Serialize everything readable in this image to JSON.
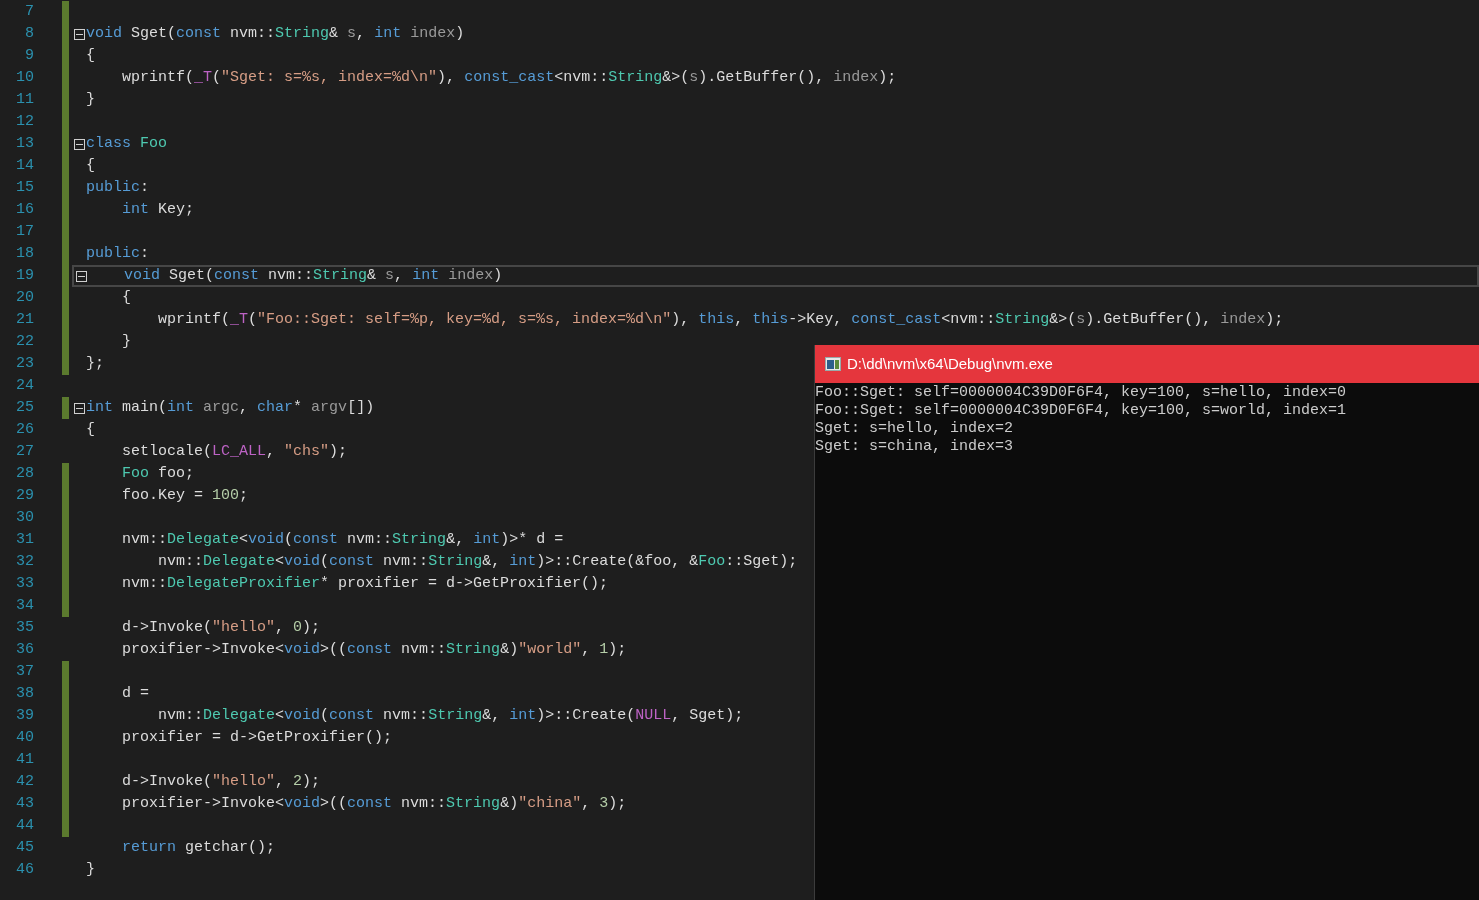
{
  "editor": {
    "lines": [
      {
        "number": "7",
        "modified": true,
        "fold": false,
        "current": false
      },
      {
        "number": "8",
        "modified": true,
        "fold": true,
        "current": false,
        "tokens": [
          {
            "kind": "keyword",
            "text": "void"
          },
          {
            "kind": "plain",
            "text": " Sget("
          },
          {
            "kind": "keyword",
            "text": "const"
          },
          {
            "kind": "plain",
            "text": " nvm::"
          },
          {
            "kind": "type",
            "text": "String"
          },
          {
            "kind": "plain",
            "text": "& "
          },
          {
            "kind": "param",
            "text": "s"
          },
          {
            "kind": "plain",
            "text": ", "
          },
          {
            "kind": "keyword",
            "text": "int"
          },
          {
            "kind": "param",
            "text": " index"
          },
          {
            "kind": "plain",
            "text": ")"
          }
        ]
      },
      {
        "number": "9",
        "modified": true,
        "fold": false,
        "current": false,
        "tokens": [
          {
            "kind": "plain",
            "text": "{"
          }
        ]
      },
      {
        "number": "10",
        "modified": true,
        "fold": false,
        "current": false,
        "tokens": [
          {
            "kind": "plain",
            "text": "    wprintf("
          },
          {
            "kind": "macro",
            "text": "_T"
          },
          {
            "kind": "plain",
            "text": "("
          },
          {
            "kind": "string",
            "text": "\"Sget: s=%s, index=%d\\n\""
          },
          {
            "kind": "plain",
            "text": "), "
          },
          {
            "kind": "keyword",
            "text": "const_cast"
          },
          {
            "kind": "plain",
            "text": "<nvm::"
          },
          {
            "kind": "type",
            "text": "String"
          },
          {
            "kind": "plain",
            "text": "&>("
          },
          {
            "kind": "param",
            "text": "s"
          },
          {
            "kind": "plain",
            "text": ").GetBuffer(), "
          },
          {
            "kind": "param",
            "text": "index"
          },
          {
            "kind": "plain",
            "text": ");"
          }
        ]
      },
      {
        "number": "11",
        "modified": true,
        "fold": false,
        "current": false,
        "tokens": [
          {
            "kind": "plain",
            "text": "}"
          }
        ]
      },
      {
        "number": "12",
        "modified": true,
        "fold": false,
        "current": false
      },
      {
        "number": "13",
        "modified": true,
        "fold": true,
        "current": false,
        "tokens": [
          {
            "kind": "keyword",
            "text": "class"
          },
          {
            "kind": "type",
            "text": " Foo"
          }
        ]
      },
      {
        "number": "14",
        "modified": true,
        "fold": false,
        "current": false,
        "tokens": [
          {
            "kind": "plain",
            "text": "{"
          }
        ]
      },
      {
        "number": "15",
        "modified": true,
        "fold": false,
        "current": false,
        "tokens": [
          {
            "kind": "keyword",
            "text": "public"
          },
          {
            "kind": "plain",
            "text": ":"
          }
        ]
      },
      {
        "number": "16",
        "modified": true,
        "fold": false,
        "current": false,
        "tokens": [
          {
            "kind": "keyword",
            "text": "    int"
          },
          {
            "kind": "plain",
            "text": " Key;"
          }
        ]
      },
      {
        "number": "17",
        "modified": true,
        "fold": false,
        "current": false
      },
      {
        "number": "18",
        "modified": true,
        "fold": false,
        "current": false,
        "tokens": [
          {
            "kind": "keyword",
            "text": "public"
          },
          {
            "kind": "plain",
            "text": ":"
          }
        ]
      },
      {
        "number": "19",
        "modified": true,
        "fold": true,
        "current": true,
        "tokens": [
          {
            "kind": "keyword",
            "text": "    void"
          },
          {
            "kind": "plain",
            "text": " Sget("
          },
          {
            "kind": "keyword",
            "text": "const"
          },
          {
            "kind": "plain",
            "text": " nvm::"
          },
          {
            "kind": "type",
            "text": "String"
          },
          {
            "kind": "plain",
            "text": "& "
          },
          {
            "kind": "param",
            "text": "s"
          },
          {
            "kind": "plain",
            "text": ", "
          },
          {
            "kind": "keyword",
            "text": "int"
          },
          {
            "kind": "param",
            "text": " index"
          },
          {
            "kind": "plain",
            "text": ")"
          }
        ]
      },
      {
        "number": "20",
        "modified": true,
        "fold": false,
        "current": false,
        "tokens": [
          {
            "kind": "plain",
            "text": "    {"
          }
        ]
      },
      {
        "number": "21",
        "modified": true,
        "fold": false,
        "current": false,
        "tokens": [
          {
            "kind": "plain",
            "text": "        wprintf("
          },
          {
            "kind": "macro",
            "text": "_T"
          },
          {
            "kind": "plain",
            "text": "("
          },
          {
            "kind": "string",
            "text": "\"Foo::Sget: self=%p, key=%d, s=%s, index=%d\\n\""
          },
          {
            "kind": "plain",
            "text": "), "
          },
          {
            "kind": "keyword",
            "text": "this"
          },
          {
            "kind": "plain",
            "text": ", "
          },
          {
            "kind": "keyword",
            "text": "this"
          },
          {
            "kind": "plain",
            "text": "->Key, "
          },
          {
            "kind": "keyword",
            "text": "const_cast"
          },
          {
            "kind": "plain",
            "text": "<nvm::"
          },
          {
            "kind": "type",
            "text": "String"
          },
          {
            "kind": "plain",
            "text": "&>("
          },
          {
            "kind": "param",
            "text": "s"
          },
          {
            "kind": "plain",
            "text": ").GetBuffer(), "
          },
          {
            "kind": "param",
            "text": "index"
          },
          {
            "kind": "plain",
            "text": ");"
          }
        ]
      },
      {
        "number": "22",
        "modified": true,
        "fold": false,
        "current": false,
        "tokens": [
          {
            "kind": "plain",
            "text": "    }"
          }
        ]
      },
      {
        "number": "23",
        "modified": true,
        "fold": false,
        "current": false,
        "tokens": [
          {
            "kind": "plain",
            "text": "};"
          }
        ]
      },
      {
        "number": "24",
        "modified": false,
        "fold": false,
        "current": false
      },
      {
        "number": "25",
        "modified": true,
        "fold": true,
        "current": false,
        "tokens": [
          {
            "kind": "keyword",
            "text": "int"
          },
          {
            "kind": "plain",
            "text": " main("
          },
          {
            "kind": "keyword",
            "text": "int"
          },
          {
            "kind": "param",
            "text": " argc"
          },
          {
            "kind": "plain",
            "text": ", "
          },
          {
            "kind": "keyword",
            "text": "char"
          },
          {
            "kind": "plain",
            "text": "* "
          },
          {
            "kind": "param",
            "text": "argv"
          },
          {
            "kind": "plain",
            "text": "[])"
          }
        ]
      },
      {
        "number": "26",
        "modified": false,
        "fold": false,
        "current": false,
        "tokens": [
          {
            "kind": "plain",
            "text": "{"
          }
        ]
      },
      {
        "number": "27",
        "modified": false,
        "fold": false,
        "current": false,
        "tokens": [
          {
            "kind": "plain",
            "text": "    setlocale("
          },
          {
            "kind": "macro",
            "text": "LC_ALL"
          },
          {
            "kind": "plain",
            "text": ", "
          },
          {
            "kind": "string",
            "text": "\"chs\""
          },
          {
            "kind": "plain",
            "text": ");"
          }
        ]
      },
      {
        "number": "28",
        "modified": true,
        "fold": false,
        "current": false,
        "tokens": [
          {
            "kind": "type",
            "text": "    Foo"
          },
          {
            "kind": "plain",
            "text": " foo;"
          }
        ]
      },
      {
        "number": "29",
        "modified": true,
        "fold": false,
        "current": false,
        "tokens": [
          {
            "kind": "plain",
            "text": "    foo.Key = "
          },
          {
            "kind": "number",
            "text": "100"
          },
          {
            "kind": "plain",
            "text": ";"
          }
        ]
      },
      {
        "number": "30",
        "modified": true,
        "fold": false,
        "current": false
      },
      {
        "number": "31",
        "modified": true,
        "fold": false,
        "current": false,
        "tokens": [
          {
            "kind": "plain",
            "text": "    nvm::"
          },
          {
            "kind": "type",
            "text": "Delegate"
          },
          {
            "kind": "plain",
            "text": "<"
          },
          {
            "kind": "keyword",
            "text": "void"
          },
          {
            "kind": "plain",
            "text": "("
          },
          {
            "kind": "keyword",
            "text": "const"
          },
          {
            "kind": "plain",
            "text": " nvm::"
          },
          {
            "kind": "type",
            "text": "String"
          },
          {
            "kind": "plain",
            "text": "&, "
          },
          {
            "kind": "keyword",
            "text": "int"
          },
          {
            "kind": "plain",
            "text": ")>* d ="
          }
        ]
      },
      {
        "number": "32",
        "modified": true,
        "fold": false,
        "current": false,
        "tokens": [
          {
            "kind": "plain",
            "text": "        nvm::"
          },
          {
            "kind": "type",
            "text": "Delegate"
          },
          {
            "kind": "plain",
            "text": "<"
          },
          {
            "kind": "keyword",
            "text": "void"
          },
          {
            "kind": "plain",
            "text": "("
          },
          {
            "kind": "keyword",
            "text": "const"
          },
          {
            "kind": "plain",
            "text": " nvm::"
          },
          {
            "kind": "type",
            "text": "String"
          },
          {
            "kind": "plain",
            "text": "&, "
          },
          {
            "kind": "keyword",
            "text": "int"
          },
          {
            "kind": "plain",
            "text": ")>::Create(&foo, &"
          },
          {
            "kind": "type",
            "text": "Foo"
          },
          {
            "kind": "plain",
            "text": "::Sget);"
          }
        ]
      },
      {
        "number": "33",
        "modified": true,
        "fold": false,
        "current": false,
        "tokens": [
          {
            "kind": "plain",
            "text": "    nvm::"
          },
          {
            "kind": "type",
            "text": "DelegateProxifier"
          },
          {
            "kind": "plain",
            "text": "* proxifier = d->GetProxifier();"
          }
        ]
      },
      {
        "number": "34",
        "modified": true,
        "fold": false,
        "current": false
      },
      {
        "number": "35",
        "modified": false,
        "fold": false,
        "current": false,
        "tokens": [
          {
            "kind": "plain",
            "text": "    d->Invoke("
          },
          {
            "kind": "string",
            "text": "\"hello\""
          },
          {
            "kind": "plain",
            "text": ", "
          },
          {
            "kind": "number",
            "text": "0"
          },
          {
            "kind": "plain",
            "text": ");"
          }
        ]
      },
      {
        "number": "36",
        "modified": false,
        "fold": false,
        "current": false,
        "tokens": [
          {
            "kind": "plain",
            "text": "    proxifier->Invoke<"
          },
          {
            "kind": "keyword",
            "text": "void"
          },
          {
            "kind": "plain",
            "text": ">(("
          },
          {
            "kind": "keyword",
            "text": "const"
          },
          {
            "kind": "plain",
            "text": " nvm::"
          },
          {
            "kind": "type",
            "text": "String"
          },
          {
            "kind": "plain",
            "text": "&)"
          },
          {
            "kind": "string",
            "text": "\"world\""
          },
          {
            "kind": "plain",
            "text": ", "
          },
          {
            "kind": "number",
            "text": "1"
          },
          {
            "kind": "plain",
            "text": ");"
          }
        ]
      },
      {
        "number": "37",
        "modified": true,
        "fold": false,
        "current": false
      },
      {
        "number": "38",
        "modified": true,
        "fold": false,
        "current": false,
        "tokens": [
          {
            "kind": "plain",
            "text": "    d ="
          }
        ]
      },
      {
        "number": "39",
        "modified": true,
        "fold": false,
        "current": false,
        "tokens": [
          {
            "kind": "plain",
            "text": "        nvm::"
          },
          {
            "kind": "type",
            "text": "Delegate"
          },
          {
            "kind": "plain",
            "text": "<"
          },
          {
            "kind": "keyword",
            "text": "void"
          },
          {
            "kind": "plain",
            "text": "("
          },
          {
            "kind": "keyword",
            "text": "const"
          },
          {
            "kind": "plain",
            "text": " nvm::"
          },
          {
            "kind": "type",
            "text": "String"
          },
          {
            "kind": "plain",
            "text": "&, "
          },
          {
            "kind": "keyword",
            "text": "int"
          },
          {
            "kind": "plain",
            "text": ")>::Create("
          },
          {
            "kind": "macro",
            "text": "NULL"
          },
          {
            "kind": "plain",
            "text": ", Sget);"
          }
        ]
      },
      {
        "number": "40",
        "modified": true,
        "fold": false,
        "current": false,
        "tokens": [
          {
            "kind": "plain",
            "text": "    proxifier = d->GetProxifier();"
          }
        ]
      },
      {
        "number": "41",
        "modified": true,
        "fold": false,
        "current": false
      },
      {
        "number": "42",
        "modified": true,
        "fold": false,
        "current": false,
        "tokens": [
          {
            "kind": "plain",
            "text": "    d->Invoke("
          },
          {
            "kind": "string",
            "text": "\"hello\""
          },
          {
            "kind": "plain",
            "text": ", "
          },
          {
            "kind": "number",
            "text": "2"
          },
          {
            "kind": "plain",
            "text": ");"
          }
        ]
      },
      {
        "number": "43",
        "modified": true,
        "fold": false,
        "current": false,
        "tokens": [
          {
            "kind": "plain",
            "text": "    proxifier->Invoke<"
          },
          {
            "kind": "keyword",
            "text": "void"
          },
          {
            "kind": "plain",
            "text": ">(("
          },
          {
            "kind": "keyword",
            "text": "const"
          },
          {
            "kind": "plain",
            "text": " nvm::"
          },
          {
            "kind": "type",
            "text": "String"
          },
          {
            "kind": "plain",
            "text": "&)"
          },
          {
            "kind": "string",
            "text": "\"china\""
          },
          {
            "kind": "plain",
            "text": ", "
          },
          {
            "kind": "number",
            "text": "3"
          },
          {
            "kind": "plain",
            "text": ");"
          }
        ]
      },
      {
        "number": "44",
        "modified": true,
        "fold": false,
        "current": false
      },
      {
        "number": "45",
        "modified": false,
        "fold": false,
        "current": false,
        "tokens": [
          {
            "kind": "keyword",
            "text": "    return"
          },
          {
            "kind": "plain",
            "text": " getchar();"
          }
        ]
      },
      {
        "number": "46",
        "modified": false,
        "fold": false,
        "current": false,
        "tokens": [
          {
            "kind": "plain",
            "text": "}"
          }
        ]
      }
    ]
  },
  "console": {
    "title": "D:\\dd\\nvm\\x64\\Debug\\nvm.exe",
    "output": [
      "Foo::Sget: self=0000004C39D0F6F4, key=100, s=hello, index=0",
      "Foo::Sget: self=0000004C39D0F6F4, key=100, s=world, index=1",
      "Sget: s=hello, index=2",
      "Sget: s=china, index=3"
    ]
  }
}
